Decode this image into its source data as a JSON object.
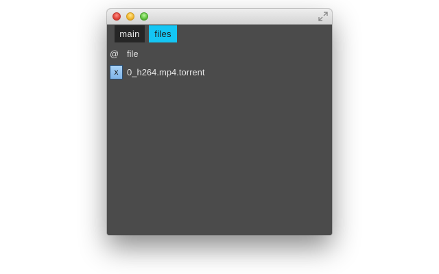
{
  "tabs": [
    {
      "label": "main",
      "active": false
    },
    {
      "label": "files",
      "active": true
    }
  ],
  "list_header": {
    "at_symbol": "@",
    "file_label": "file"
  },
  "files": [
    {
      "remove_label": "x",
      "name": "0_h264.mp4.torrent"
    }
  ],
  "colors": {
    "content_bg": "#4b4b4b",
    "tab_main_bg": "#262626",
    "tab_active_bg": "#14c6f4",
    "remove_button_bg": "#8fc2ef"
  },
  "icons": {
    "titlebar": [
      "close-icon",
      "minimize-icon",
      "zoom-icon",
      "fullscreen-icon"
    ]
  }
}
